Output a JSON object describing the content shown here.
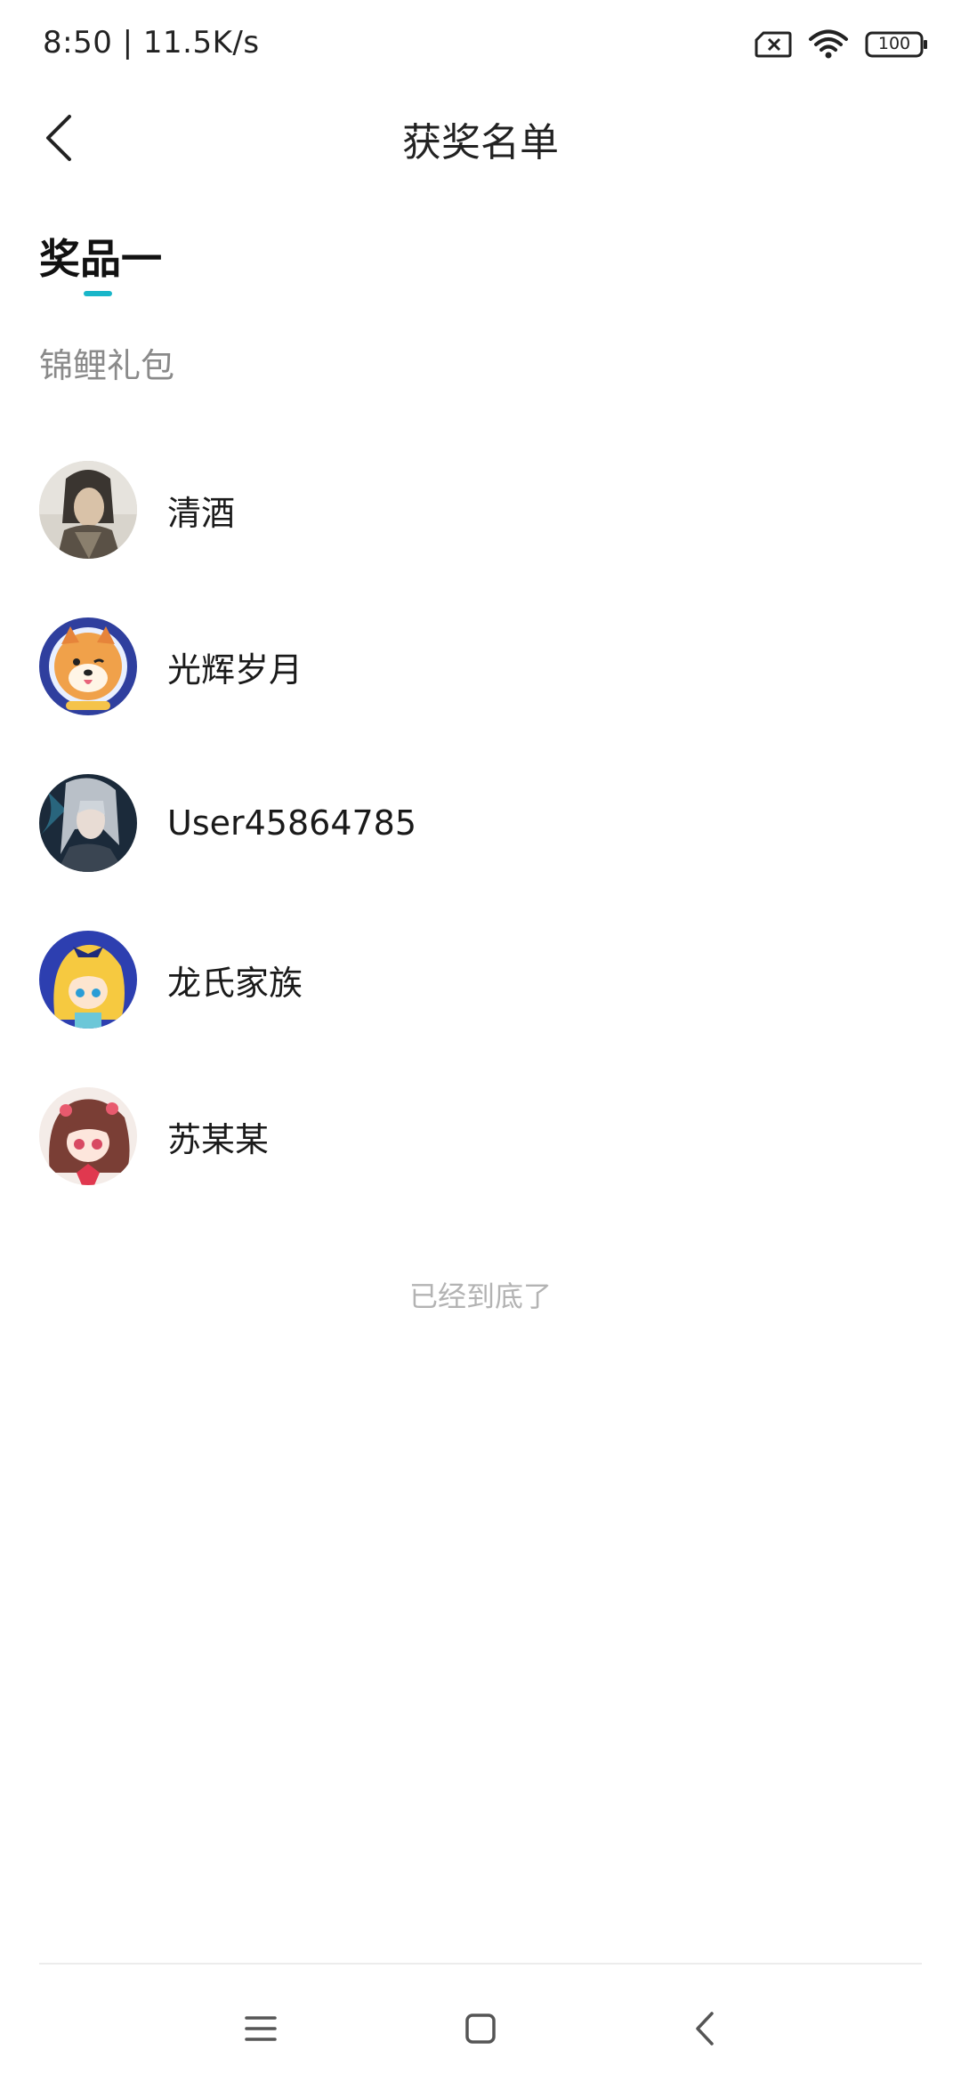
{
  "status_bar": {
    "time_speed": "8:50 | 11.5K/s",
    "battery": "100",
    "icons": [
      "sim-error-icon",
      "wifi-icon",
      "battery-icon"
    ]
  },
  "header": {
    "title": "获奖名单",
    "back_icon": "back-arrow-icon"
  },
  "prize": {
    "tab_label": "奖品一",
    "name": "锦鲤礼包",
    "accent_color": "#19b6c9"
  },
  "winners": [
    {
      "name": "清酒",
      "avatar": "avatar-warrior"
    },
    {
      "name": "光辉岁月",
      "avatar": "avatar-shiba-astronaut"
    },
    {
      "name": "User45864785",
      "avatar": "avatar-silver-hair"
    },
    {
      "name": "龙氏家族",
      "avatar": "avatar-blonde-girl"
    },
    {
      "name": "苏某某",
      "avatar": "avatar-anime-girl"
    }
  ],
  "footer": {
    "end_text": "已经到底了"
  },
  "nav_bar": {
    "icons": [
      "menu-icon",
      "home-icon",
      "back-icon"
    ]
  }
}
